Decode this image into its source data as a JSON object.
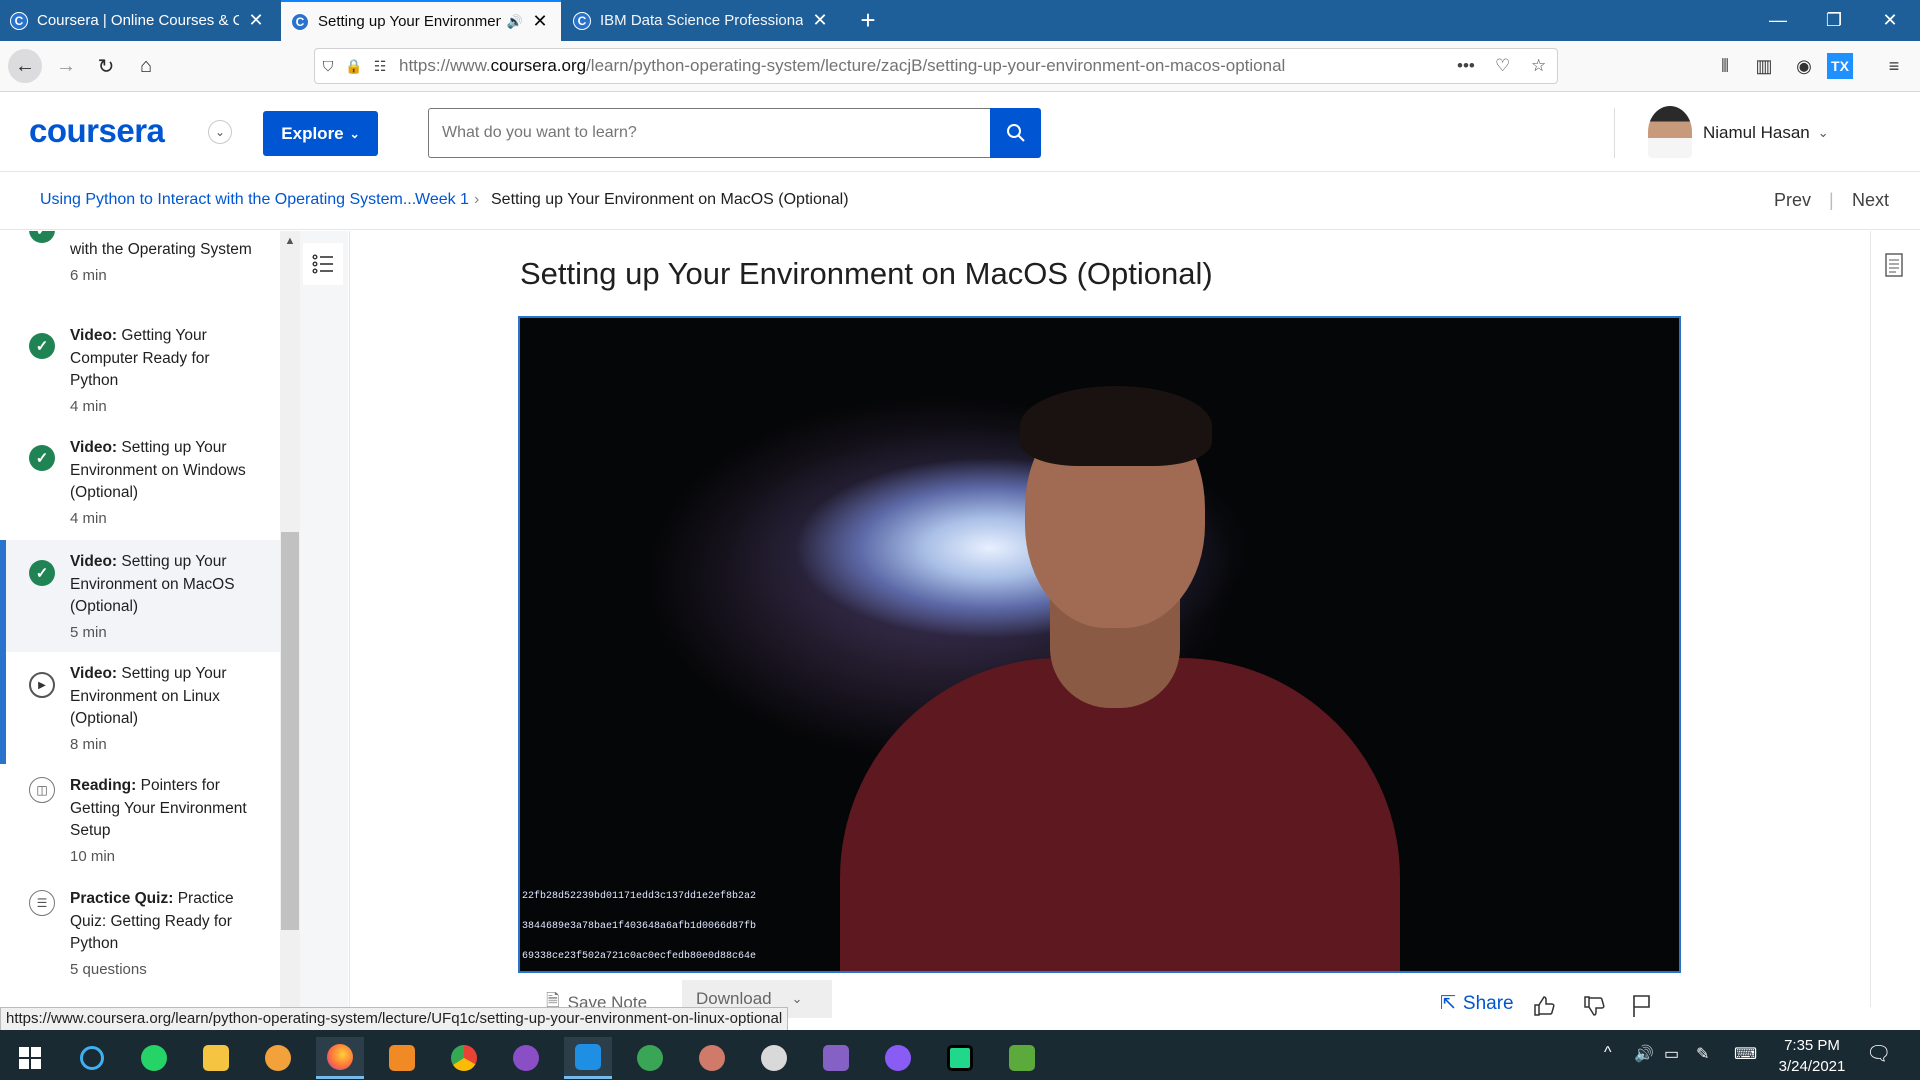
{
  "browser": {
    "tabs": [
      {
        "title": "Coursera | Online Courses & Cre",
        "active": false,
        "icon": "coursera-favicon"
      },
      {
        "title": "Setting up Your Environmen",
        "active": true,
        "icon": "coursera-favicon",
        "audio": true
      },
      {
        "title": "IBM Data Science Professional C",
        "active": false,
        "icon": "coursera-favicon"
      }
    ],
    "url_prefix": "https://www.",
    "url_host": "coursera.org",
    "url_path": "/learn/python-operating-system/lecture/zacjB/setting-up-your-environment-on-macos-optional",
    "status_url": "https://www.coursera.org/learn/python-operating-system/lecture/UFq1c/setting-up-your-environment-on-linux-optional"
  },
  "header": {
    "logo": "coursera",
    "explore_label": "Explore",
    "search_placeholder": "What do you want to learn?",
    "user_name": "Niamul Hasan"
  },
  "breadcrumb": {
    "course": "Using Python to Interact with the Operating System...",
    "week": "Week 1",
    "separator": "›",
    "current": "Setting up Your Environment on MacOS (Optional)",
    "prev_label": "Prev",
    "next_label": "Next"
  },
  "sidebar": {
    "items": [
      {
        "kind": "",
        "title": "with the Operating System",
        "duration": "6 min",
        "status": "done",
        "partial": true
      },
      {
        "kind": "Video:",
        "title": "Getting Your Computer Ready for Python",
        "duration": "4 min",
        "status": "done"
      },
      {
        "kind": "Video:",
        "title": "Setting up Your Environment on Windows (Optional)",
        "duration": "4 min",
        "status": "done"
      },
      {
        "kind": "Video:",
        "title": "Setting up Your Environment on MacOS (Optional)",
        "duration": "5 min",
        "status": "done",
        "active": true
      },
      {
        "kind": "Video:",
        "title": "Setting up Your Environment on Linux (Optional)",
        "duration": "8 min",
        "status": "play"
      },
      {
        "kind": "Reading:",
        "title": "Pointers for Getting Your Environment Setup",
        "duration": "10 min",
        "status": "reading"
      },
      {
        "kind": "Practice Quiz:",
        "title": "Practice Quiz: Getting Ready for Python",
        "duration": "5 questions",
        "status": "quiz"
      }
    ]
  },
  "lecture": {
    "title": "Setting up Your Environment on MacOS (Optional)",
    "video_overlay_lines": [
      "22fb28d52239bd01171edd3c137dd1e2ef8b2a2",
      "3844689e3a78bae1f403648a6afb1d0066d87fb",
      "69338ce23f502a721c0ac0ecfedb80e0d88c64e"
    ],
    "save_note_label": "Save Note",
    "download_label": "Download",
    "share_label": "Share"
  },
  "taskbar": {
    "time": "7:35 PM",
    "date": "3/24/2021"
  },
  "colors": {
    "brand": "#0056d2",
    "tabbar": "#1e5f99",
    "complete": "#1f8354",
    "taskbar": "#1a2a33"
  }
}
